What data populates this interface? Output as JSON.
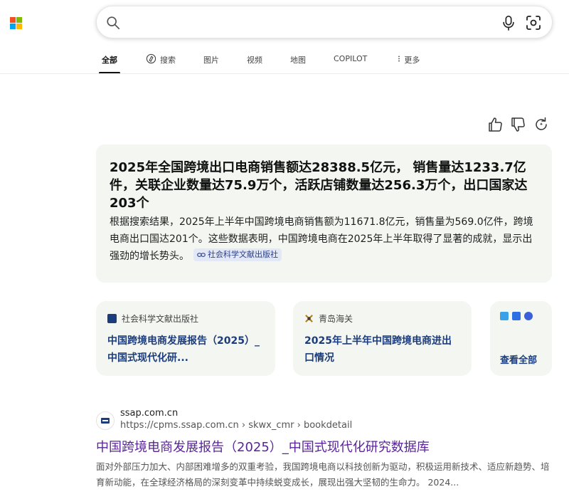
{
  "logo": {
    "colors": [
      "#f25022",
      "#7fba00",
      "#00a4ef",
      "#ffb900"
    ]
  },
  "search": {
    "value": "",
    "placeholder": "",
    "icons": [
      "search-icon",
      "mic-icon",
      "visual-search-icon"
    ]
  },
  "tabs": [
    {
      "label": "全部",
      "active": true
    },
    {
      "label": "搜索",
      "icon": "copilot-search-icon"
    },
    {
      "label": "图片"
    },
    {
      "label": "视频"
    },
    {
      "label": "地图"
    },
    {
      "label": "COPILOT"
    },
    {
      "label": "更多",
      "icon": "more-vertical-icon"
    }
  ],
  "feedback": {
    "icons": [
      "thumbs-up-icon",
      "thumbs-down-icon",
      "refresh-icon"
    ]
  },
  "answer": {
    "title": "2025年全国跨境出口电商销售额达28388.5亿元， 销售量达1233.7亿件，关联企业数量达75.9万个，活跃店铺数量达256.3万个，出口国家达203个",
    "body": "根据搜索结果，2025年上半年中国跨境电商销售额为11671.8亿元，销售量为569.0亿件，跨境电商出口国达201个。这些数据表明，中国跨境电商在2025年上半年取得了显著的成就，显示出强劲的增长势头。",
    "source_chip": "社会科学文献出版社"
  },
  "source_cards": [
    {
      "publisher": "社会科学文献出版社",
      "title": "中国跨境电商发展报告（2025）_中国式现代化研..."
    },
    {
      "publisher": "青岛海关",
      "title": "2025年上半年中国跨境电商进出口情况"
    }
  ],
  "see_all": {
    "label": "查看全部"
  },
  "result": {
    "site": "ssap.com.cn",
    "url": "https://cpms.ssap.com.cn › skwx_cmr › bookdetail",
    "title": "中国跨境电商发展报告（2025）_中国式现代化研究数据库",
    "snippet": "面对外部压力加大、内部困难增多的双重考验，我国跨境电商以科技创新为驱动，积极运用新技术、适应新趋势、培育新动能，在全球经济格局的深刻变革中持续蜕变成长，展现出强大坚韧的生命力。 2024..."
  },
  "colors": {
    "link_title": "#5a2599",
    "card_bg": "#f4f6f1",
    "card_title": "#1b3c7d",
    "chip_bg": "#e3e8f6"
  }
}
